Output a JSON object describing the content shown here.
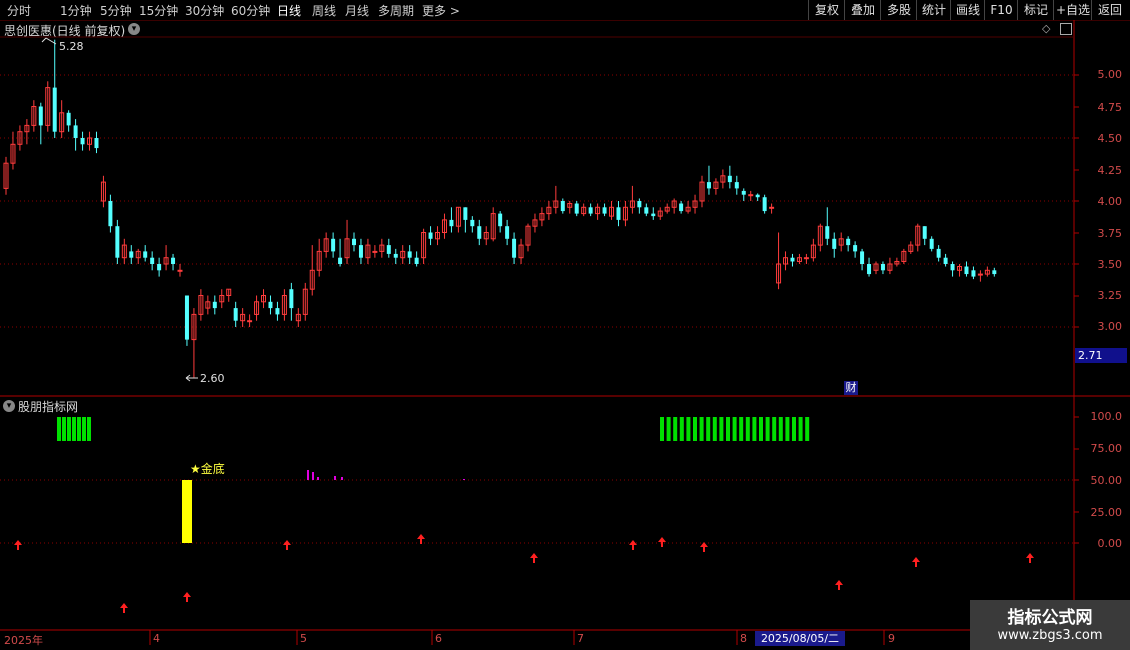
{
  "toolbar": {
    "periods": [
      "分时",
      "1分钟",
      "5分钟",
      "15分钟",
      "30分钟",
      "60分钟",
      "日线",
      "周线",
      "月线",
      "多周期",
      "更多 >"
    ],
    "active_period": "日线",
    "actions": [
      "复权",
      "叠加",
      "多股",
      "统计",
      "画线",
      "F10",
      "标记",
      "+自选",
      "返回"
    ]
  },
  "main_chart": {
    "title": "思创医惠(日线 前复权)",
    "high_label": "5.28",
    "low_label": "2.60",
    "y_ticks": [
      "5.00",
      "4.75",
      "4.50",
      "4.25",
      "4.00",
      "3.75",
      "3.50",
      "3.25",
      "3.00"
    ],
    "current_price": "2.71",
    "finance_marker": "财"
  },
  "indicator": {
    "title": "股朋指标网",
    "y_ticks": [
      "100.0",
      "75.00",
      "50.00",
      "25.00",
      "0.00"
    ],
    "signal_label": "★金底"
  },
  "x_axis": {
    "labels": [
      "2025年",
      "4",
      "5",
      "6",
      "7",
      "8",
      "9"
    ],
    "selected_date": "2025/08/05/二"
  },
  "colors": {
    "up": "#ff3c3c",
    "down": "#54ffff",
    "grid": "#8b0000",
    "green_bar": "#00e000",
    "yellow_bar": "#ffff00",
    "magenta": "#e000e0",
    "arrow": "#ff2020"
  },
  "watermark": {
    "title": "指标公式网",
    "url": "www.zbgs3.com"
  }
}
